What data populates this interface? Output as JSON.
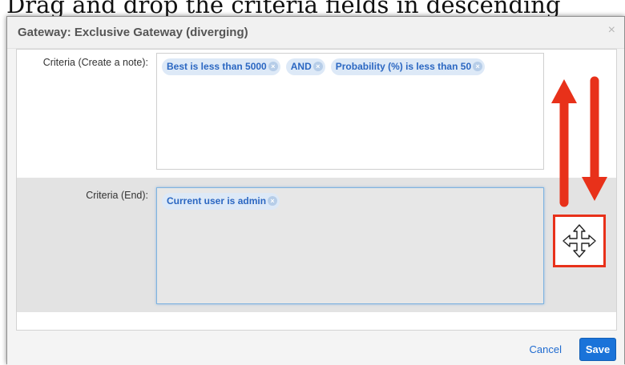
{
  "heading": "Drag and drop the criteria fields in descending",
  "dialog": {
    "title": "Gateway: Exclusive Gateway (diverging)",
    "close_symbol": "×",
    "rows": [
      {
        "label": "Criteria (Create a note):",
        "tokens": [
          "Best is less than 5000",
          "AND",
          "Probability (%) is less than 50"
        ]
      },
      {
        "label": "Criteria (End):",
        "tokens": [
          "Current user is admin"
        ]
      }
    ],
    "token_remove_symbol": "×",
    "footer": {
      "cancel_label": "Cancel",
      "save_label": "Save"
    }
  },
  "annotations": {
    "up_arrow_icon": "arrow-up-icon",
    "down_arrow_icon": "arrow-down-icon",
    "move_icon": "move-icon",
    "highlight_color": "#e8311a"
  },
  "colors": {
    "accent": "#1a73d9",
    "token_bg": "#dde9f7",
    "token_text": "#2b67c2"
  }
}
